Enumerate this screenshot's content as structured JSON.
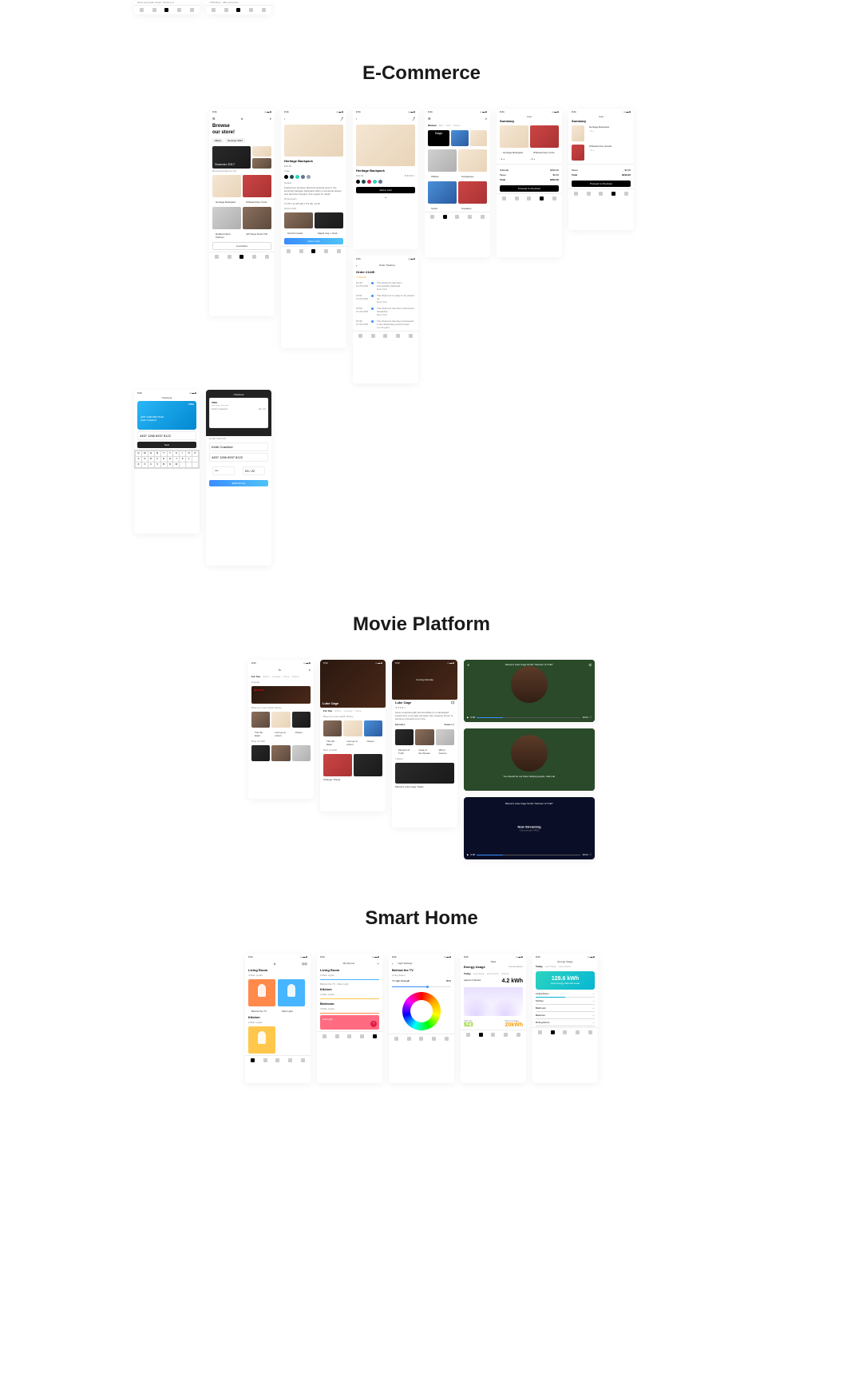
{
  "sections": {
    "ecommerce": "E-Commerce",
    "movie": "Movie Platform",
    "smarthome": "Smart Home"
  },
  "status": {
    "time": "9:41"
  },
  "shop": {
    "browse_l1": "Browse",
    "browse_l2": "our store!",
    "filters": "Filters",
    "recommended": "Recommended for you",
    "summer": "Summer 2017",
    "p1": "Heritage Backpack",
    "p2": "Whitetail Deer Knife",
    "p3": "Radiant Flash Pullover",
    "p4": "Jeff Stops Rush Pull",
    "loadmore": "Load More"
  },
  "product": {
    "title": "Heritage Backpack",
    "price": "$39.99",
    "color": "Color",
    "details": "Details",
    "desc": "Featuring a timeless diamond shaped accent, the Herschel Heritage backpack offers a functional design and Herschel Supply's fine regard for detail.",
    "dimensions": "Dimensions",
    "dimval": "17.25 x 12.25 (W) x 5.5 (D), 21.5L",
    "works": "Works With",
    "w1": "Utrecht Insider",
    "w2": "Maple Cap + Neck",
    "addcart": "Add to Cart"
  },
  "detail": {
    "title": "Heritage Backpack",
    "price": "$39.99",
    "addcart": "Add to Cart"
  },
  "order": {
    "header": "Order Tracking",
    "title": "Order #1445",
    "status": "In Transit",
    "s1_t": "14:49",
    "s1_d": "12.05.2018",
    "s1_m": "The shipment has been successfully delivered",
    "s1_c": "New York",
    "s2_t": "12:01",
    "s2_d": "12.05.2018",
    "s2_m": "The shipment is ready to be picked up",
    "s2_c": "New York",
    "s3_t": "10:50",
    "s3_d": "12.05.2018",
    "s3_m": "The shipment has been sorted and forwarded",
    "s3_c": "New York",
    "s4_t": "07:46",
    "s4_d": "12.05.2018",
    "s4_m": "The shipment has been processed in the destination parcel center",
    "s4_c": "Los Angeles"
  },
  "categories": {
    "tabs": [
      "Women",
      "Men",
      "Kids",
      "Unisex"
    ],
    "bags": "Bags",
    "wallets": "Wallets",
    "sunglasses": "Sunglasses",
    "socks": "Socks",
    "sneakers": "Sneakers"
  },
  "cart": {
    "title": "Cart",
    "summary": "Summary",
    "item1": "Heritage Backpack",
    "item2": "Whitetail Deer Knife",
    "subtotal": "Subtotal",
    "subtotal_v": "$290.00",
    "taxes": "Taxes",
    "taxes_v": "$0.00",
    "total": "Total",
    "total_v": "$290.00",
    "proceed": "Proceed to Checkout",
    "n1": "1",
    "item3": "Whitetail Grip Hoodie",
    "total2": "$249.00"
  },
  "checkout": {
    "title": "Checkout",
    "visa": "VISA",
    "cardnum": "4457 1266 6937 8122",
    "name": "Keith Crawford",
    "maskedcard": "4457 1266 6937 8122",
    "next": "Next",
    "creditinfo": "Credit Card Info",
    "exp": "03 / 22",
    "cvv": "***",
    "pay": "$290.00 Pay"
  },
  "movies": {
    "tabs": [
      "For You",
      "Action",
      "Comedy",
      "Crime",
      "Drama"
    ],
    "popular": "Popular",
    "basedon": "Based on your watch history",
    "bestof": "Best of 2018",
    "lukecage": "Luke Cage",
    "coming": "Coming Monday",
    "desc": "Given superstrength and durability by a sabotaged experiment, a wrongly accused man escapes prison to become a superhero for hire.",
    "episodes": "Episodes",
    "season": "Season 1",
    "trailers": "Trailers",
    "mt1": "The Sin Eater",
    "mt2": "Let's go to prison",
    "mt3": "Ocean",
    "ep1": "Moment of Truth",
    "ep2": "Code of the Streets",
    "ep3": "Who's Gonna...",
    "trailer_t": "Marvel's Luke Cage Trailer",
    "stranger": "Stranger Things"
  },
  "player": {
    "title": "Marvel's Luke Cage S1:E1 \"Moment of Truth\"",
    "subtitle": "You should be out there helping people, that's all.",
    "now": "Now Streaming",
    "device": "Chromecast HR01",
    "t0": "0:00",
    "t1": "18:24"
  },
  "home": {
    "living": "Living Room",
    "kmain": "4 Main Lights",
    "kitchen": "Kitchen",
    "k2": "2 Main Lights",
    "bedroom": "Bedroom",
    "k3": "3 Main Lights",
    "myrooms": "My Rooms",
    "lbl_behindtv": "Behind the TV",
    "lbl_mainlight": "Main Light",
    "lightsettings": "Light Settings",
    "behindtv": "Behind the TV",
    "lroom": "Living Room",
    "lightstrength": "Light Strength",
    "pct": "80%",
    "stats": "Stats",
    "energyusage": "Energy Usage",
    "consumption": "Consumption",
    "ttabs": [
      "Today",
      "Last Week",
      "Last Month",
      "Lifetime"
    ],
    "savings": "Savings",
    "savings_v": "$23",
    "roomusage": "Room Usage",
    "roomusage_v": "20kWh",
    "kwh": "4.2 kWh",
    "last": "Last on 3 Hours",
    "eu_title": "Energy Usage",
    "bigkwh": "128.6 kWh",
    "bigkwh_sub": "Less energy than last week",
    "rooms": [
      "Living Room",
      "Kitchen",
      "Bathroom",
      "Bedroom",
      "Dining Room"
    ]
  },
  "kb_keys": [
    "Q",
    "W",
    "E",
    "R",
    "T",
    "Y",
    "U",
    "I",
    "O",
    "P",
    "A",
    "S",
    "D",
    "F",
    "G",
    "H",
    "J",
    "K",
    "L",
    "",
    "Z",
    "X",
    "C",
    "V",
    "B",
    "N",
    "M"
  ]
}
